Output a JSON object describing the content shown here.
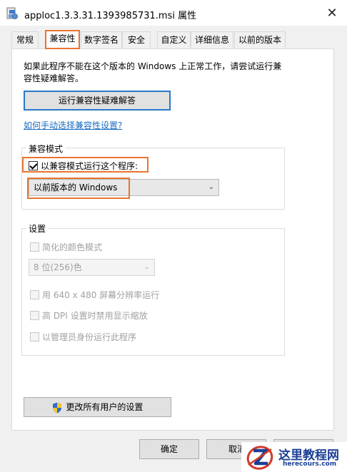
{
  "window": {
    "title": "apploc1.3.3.31.1393985731.msi 属性",
    "close_glyph": "✕"
  },
  "tabs": [
    {
      "label": "常规"
    },
    {
      "label": "兼容性"
    },
    {
      "label": "数字签名"
    },
    {
      "label": "安全"
    },
    {
      "label": "自定义"
    },
    {
      "label": "详细信息"
    },
    {
      "label": "以前的版本"
    }
  ],
  "active_tab": "兼容性",
  "compat": {
    "intro_line1": "如果此程序不能在这个版本的 Windows 上正常工作，请尝试运行兼",
    "intro_line2": "容性疑难解答。",
    "troubleshoot_label": "运行兼容性疑难解答",
    "help_link": "如何手动选择兼容性设置?",
    "mode_group_label": "兼容模式",
    "mode_checkbox_label": "以兼容模式运行这个程序:",
    "mode_checked": true,
    "mode_select_value": "以前版本的 Windows",
    "settings_group_label": "设置",
    "reduced_color_label": "简化的颜色模式",
    "color_select_value": "8 位(256)色",
    "res_label": "用 640 x 480 屏幕分辨率运行",
    "dpi_label": "高 DPI 设置时禁用显示缩放",
    "admin_run_label": "以管理员身份运行此程序",
    "all_users_label": "更改所有用户的设置"
  },
  "buttons": {
    "ok": "确定",
    "cancel": "取消",
    "apply": ""
  },
  "watermark": {
    "title": "这里教程网",
    "url": "herecours.com"
  },
  "colors": {
    "highlight": "#e8752f",
    "focus_border": "#2a79c8",
    "link": "#1a6cc0",
    "watermark_blue": "#1c3f95"
  }
}
